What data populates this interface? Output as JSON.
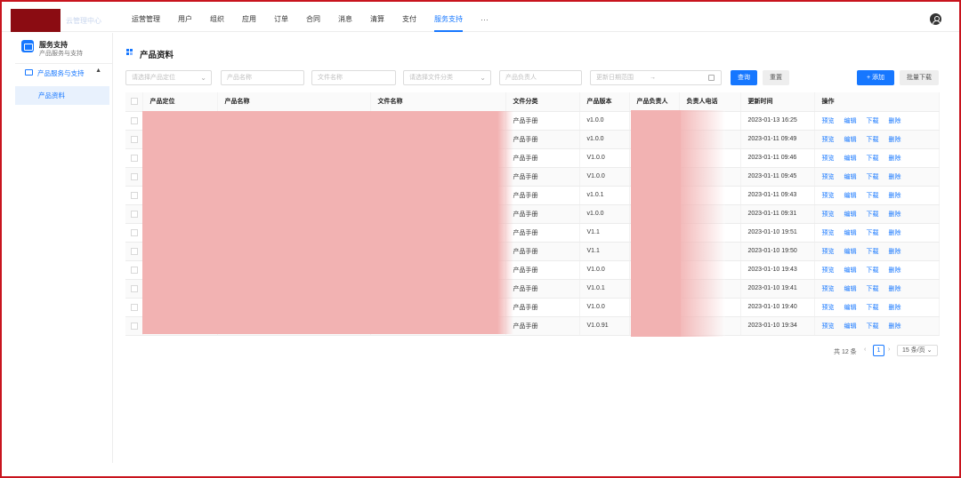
{
  "header": {
    "logo_text": "云管理中心",
    "nav": [
      "运营管理",
      "用户",
      "组织",
      "应用",
      "订单",
      "合同",
      "消息",
      "清算",
      "支付",
      "服务支持"
    ],
    "active_nav": "服务支持",
    "more": "···"
  },
  "sidebar": {
    "title": "服务支持",
    "subtitle": "产品服务与支持",
    "group_label": "产品服务与支持",
    "items": [
      {
        "label": "产品资料",
        "active": true
      }
    ]
  },
  "page": {
    "title": "产品资料"
  },
  "filters": {
    "positioning_placeholder": "请选择产品定位",
    "product_name_placeholder": "产品名称",
    "file_name_placeholder": "文件名称",
    "file_category_placeholder": "请选择文件分类",
    "owner_placeholder": "产品负责人",
    "date_range_placeholder": "更新日期范围",
    "date_range_arrow": "→"
  },
  "buttons": {
    "search": "查询",
    "reset": "重置",
    "add": "+ 添加",
    "batch_download": "批量下载"
  },
  "table": {
    "columns": [
      "产品定位",
      "产品名称",
      "文件名称",
      "文件分类",
      "产品版本",
      "产品负责人",
      "负责人电话",
      "更新时间",
      "操作"
    ],
    "ops": [
      "预览",
      "编辑",
      "下载",
      "删除"
    ],
    "rows": [
      {
        "category": "产品手册",
        "version": "v1.0.0",
        "updated": "2023-01-13 16:25"
      },
      {
        "category": "产品手册",
        "version": "v1.0.0",
        "updated": "2023-01-11 09:49"
      },
      {
        "category": "产品手册",
        "version": "V1.0.0",
        "updated": "2023-01-11 09:46"
      },
      {
        "category": "产品手册",
        "version": "V1.0.0",
        "updated": "2023-01-11 09:45"
      },
      {
        "category": "产品手册",
        "version": "v1.0.1",
        "updated": "2023-01-11 09:43"
      },
      {
        "category": "产品手册",
        "version": "v1.0.0",
        "updated": "2023-01-11 09:31"
      },
      {
        "category": "产品手册",
        "version": "V1.1",
        "updated": "2023-01-10 19:51"
      },
      {
        "category": "产品手册",
        "version": "V1.1",
        "updated": "2023-01-10 19:50"
      },
      {
        "category": "产品手册",
        "version": "V1.0.0",
        "updated": "2023-01-10 19:43"
      },
      {
        "category": "产品手册",
        "version": "V1.0.1",
        "updated": "2023-01-10 19:41"
      },
      {
        "category": "产品手册",
        "version": "V1.0.0",
        "updated": "2023-01-10 19:40"
      },
      {
        "category": "产品手册",
        "version": "V1.0.91",
        "updated": "2023-01-10 19:34"
      }
    ]
  },
  "pagination": {
    "total": "共 12 条",
    "prev": "‹",
    "current": "1",
    "next": "›",
    "page_size": "15 条/页"
  },
  "colors": {
    "accent": "#1677ff",
    "frame": "#c8141e",
    "redaction": "#f2b2b2"
  }
}
